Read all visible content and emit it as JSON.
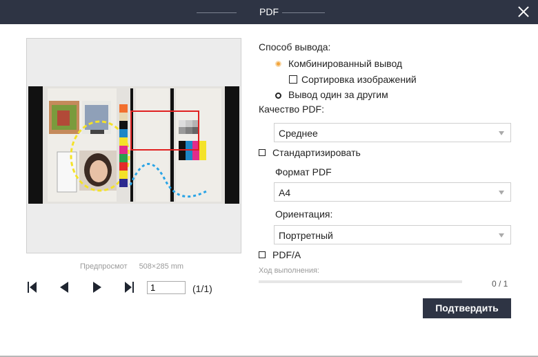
{
  "window": {
    "title": "PDF"
  },
  "preview": {
    "label": "Предпросмот",
    "size": "508×285 mm"
  },
  "pager": {
    "page_value": "1",
    "page_count": "(1/1)"
  },
  "output": {
    "heading": "Способ вывода:",
    "options": [
      {
        "label": "Комбинированный вывод",
        "selected": true
      },
      {
        "label": "Вывод один за другим",
        "selected": false
      }
    ],
    "sort_images": {
      "label": "Сортировка изображений",
      "checked": false
    }
  },
  "quality": {
    "heading": "Качество PDF:",
    "value": "Среднее"
  },
  "standardize": {
    "label": "Стандартизировать",
    "checked": false
  },
  "format": {
    "heading": "Формат PDF",
    "value": "A4"
  },
  "orientation": {
    "heading": "Ориентация:",
    "value": "Портретный"
  },
  "pdfa": {
    "label": "PDF/A",
    "checked": false
  },
  "progress": {
    "label": "Ход выполнения:",
    "count": "0 / 1",
    "percent": 0
  },
  "confirm": {
    "label": "Подтвердить"
  },
  "colors": {
    "title_bar": "#2e3444",
    "accent": "#f3a53d",
    "highlight": "#e02020"
  }
}
